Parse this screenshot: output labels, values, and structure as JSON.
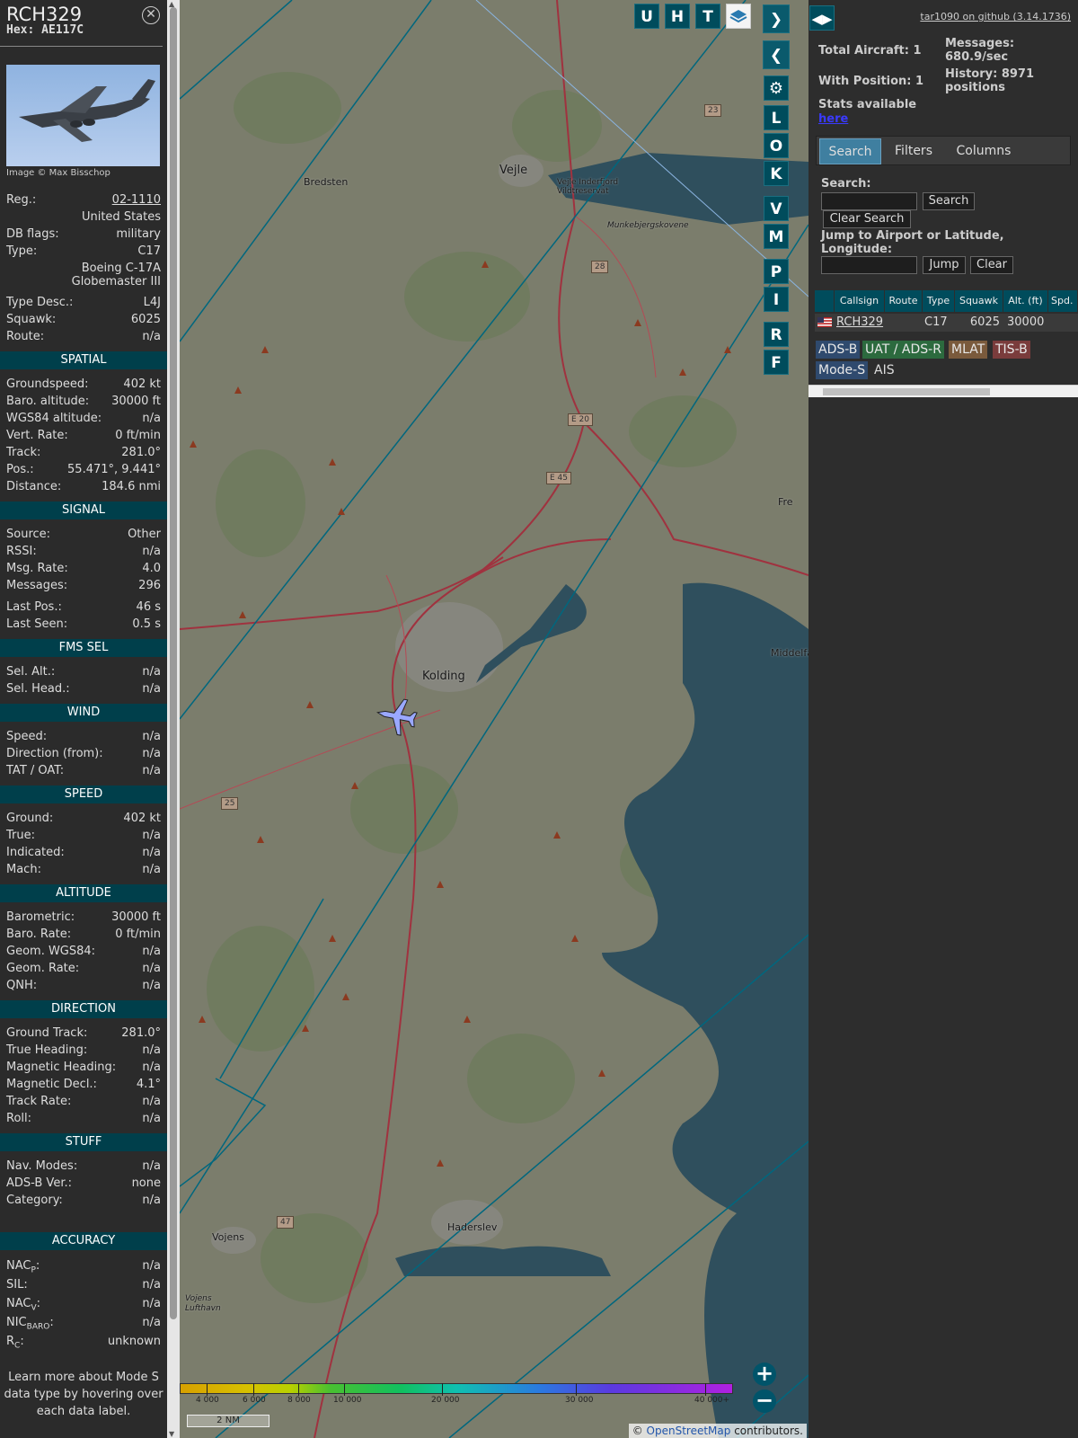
{
  "infobox": {
    "callsign": "RCH329",
    "hex": "Hex: AE117C",
    "image_credit": "Image © Max Bisschop",
    "general": [
      {
        "k": "Reg.:",
        "v": "02-1110",
        "link": true
      },
      {
        "k": "",
        "v": "United States"
      },
      {
        "k": "DB flags:",
        "v": "military"
      },
      {
        "k": "Type:",
        "v": "C17"
      },
      {
        "k": "",
        "v": "Boeing C-17A Globemaster III"
      },
      {
        "k": "Type Desc.:",
        "v": "L4J"
      },
      {
        "k": "Squawk:",
        "v": "6025"
      },
      {
        "k": "Route:",
        "v": "n/a"
      }
    ],
    "sections": [
      {
        "title": "SPATIAL",
        "rows": [
          {
            "k": "Groundspeed:",
            "v": "402 kt"
          },
          {
            "k": "Baro. altitude:",
            "v": "30000 ft"
          },
          {
            "k": "WGS84 altitude:",
            "v": "n/a"
          },
          {
            "k": "Vert. Rate:",
            "v": "0 ft/min"
          },
          {
            "k": "Track:",
            "v": "281.0°"
          },
          {
            "k": "Pos.:",
            "v": "55.471°, 9.441°"
          },
          {
            "k": "Distance:",
            "v": "184.6 nmi"
          }
        ]
      },
      {
        "title": "SIGNAL",
        "rows": [
          {
            "k": "Source:",
            "v": "Other"
          },
          {
            "k": "RSSI:",
            "v": "n/a"
          },
          {
            "k": "Msg. Rate:",
            "v": "4.0"
          },
          {
            "k": "Messages:",
            "v": "296"
          },
          {
            "k": "Last Pos.:",
            "v": "46 s"
          },
          {
            "k": "Last Seen:",
            "v": "0.5 s"
          }
        ]
      },
      {
        "title": "FMS SEL",
        "rows": [
          {
            "k": "Sel. Alt.:",
            "v": "n/a"
          },
          {
            "k": "Sel. Head.:",
            "v": "n/a"
          }
        ]
      },
      {
        "title": "WIND",
        "rows": [
          {
            "k": "Speed:",
            "v": "n/a"
          },
          {
            "k": "Direction (from):",
            "v": "n/a"
          },
          {
            "k": "TAT / OAT:",
            "v": "n/a"
          }
        ]
      },
      {
        "title": "SPEED",
        "rows": [
          {
            "k": "Ground:",
            "v": "402 kt"
          },
          {
            "k": "True:",
            "v": "n/a"
          },
          {
            "k": "Indicated:",
            "v": "n/a"
          },
          {
            "k": "Mach:",
            "v": "n/a"
          }
        ]
      },
      {
        "title": "ALTITUDE",
        "rows": [
          {
            "k": "Barometric:",
            "v": "30000 ft"
          },
          {
            "k": "Baro. Rate:",
            "v": "0 ft/min"
          },
          {
            "k": "Geom. WGS84:",
            "v": "n/a"
          },
          {
            "k": "Geom. Rate:",
            "v": "n/a"
          },
          {
            "k": "QNH:",
            "v": "n/a"
          }
        ]
      },
      {
        "title": "DIRECTION",
        "rows": [
          {
            "k": "Ground Track:",
            "v": "281.0°"
          },
          {
            "k": "True Heading:",
            "v": "n/a"
          },
          {
            "k": "Magnetic Heading:",
            "v": "n/a"
          },
          {
            "k": "Magnetic Decl.:",
            "v": "4.1°"
          },
          {
            "k": "Track Rate:",
            "v": "n/a"
          },
          {
            "k": "Roll:",
            "v": "n/a"
          }
        ]
      },
      {
        "title": "STUFF",
        "rows": [
          {
            "k": "Nav. Modes:",
            "v": "n/a"
          },
          {
            "k": "ADS-B Ver.:",
            "v": "none"
          },
          {
            "k": "Category:",
            "v": "n/a"
          }
        ]
      }
    ],
    "accuracy_title": "ACCURACY",
    "accuracy": [
      {
        "k": "NAC",
        "sub": "P",
        "v": "n/a"
      },
      {
        "k": "SIL:",
        "sub": "",
        "v": "n/a"
      },
      {
        "k": "NAC",
        "sub": "V",
        "v": "n/a"
      },
      {
        "k": "NIC",
        "sub": "BARO",
        "v": "n/a"
      },
      {
        "k": "R",
        "sub": "C",
        "v": "unknown"
      }
    ],
    "note": "Learn more about Mode S data type by hovering over each data label."
  },
  "map": {
    "buttons_top": [
      "U",
      "H",
      "T"
    ],
    "buttons_side": [
      "L",
      "O",
      "K",
      "V",
      "M",
      "P",
      "I",
      "R",
      "F"
    ],
    "places": [
      {
        "name": "Vejle",
        "big": true
      },
      {
        "name": "Bredsten"
      },
      {
        "name": "Vejle Inderfjord Vildtreservat"
      },
      {
        "name": "Munkebjergskovene"
      },
      {
        "name": "Kolding",
        "big": true
      },
      {
        "name": "Haderslev"
      },
      {
        "name": "Vojens"
      },
      {
        "name": "Middelfa"
      },
      {
        "name": "Fre"
      },
      {
        "name": "Vojens Lufthavn"
      }
    ],
    "roads": [
      "E 20",
      "E 45",
      "28",
      "25",
      "47",
      "23"
    ],
    "colorbar_ticks": [
      "4 000",
      "6 000",
      "8 000",
      "10 000",
      "20 000",
      "30 000",
      "40 000+"
    ],
    "scale": "2 NM",
    "attribution": {
      "pre": "© ",
      "link": "OpenStreetMap",
      "post": " contributors."
    },
    "zoom_in": "+",
    "zoom_out": "−"
  },
  "panel": {
    "github": "tar1090 on github (3.14.1736)",
    "total_aircraft": "Total Aircraft: 1",
    "with_position": "With Position: 1",
    "messages": "Messages: 680.9/sec",
    "history": "History: 8971 positions",
    "stats_label": "Stats available",
    "stats_link": "here",
    "tabs": [
      "Search",
      "Filters",
      "Columns"
    ],
    "search_label": "Search:",
    "search_button": "Search",
    "clear_search_button": "Clear Search",
    "jump_label": "Jump to Airport or Latitude, Longitude:",
    "jump_button": "Jump",
    "clear_button": "Clear",
    "table": {
      "columns": [
        "Callsign",
        "Route",
        "Type",
        "Squawk",
        "Alt. (ft)",
        "Spd."
      ],
      "rows": [
        {
          "callsign": "RCH329",
          "route": "",
          "type": "C17",
          "squawk": "6025",
          "alt": "30000",
          "spd": ""
        }
      ]
    },
    "sources": [
      {
        "name": "ADS-B",
        "bg": "#2f4a6e"
      },
      {
        "name": "UAT / ADS-R",
        "bg": "#2c6a3e"
      },
      {
        "name": "MLAT",
        "bg": "#7a5a3c"
      },
      {
        "name": "TIS-B",
        "bg": "#7a3c3c"
      },
      {
        "name": "Mode-S",
        "bg": "#2f4a6e"
      },
      {
        "name": "AIS",
        "bg": "transparent"
      }
    ]
  }
}
